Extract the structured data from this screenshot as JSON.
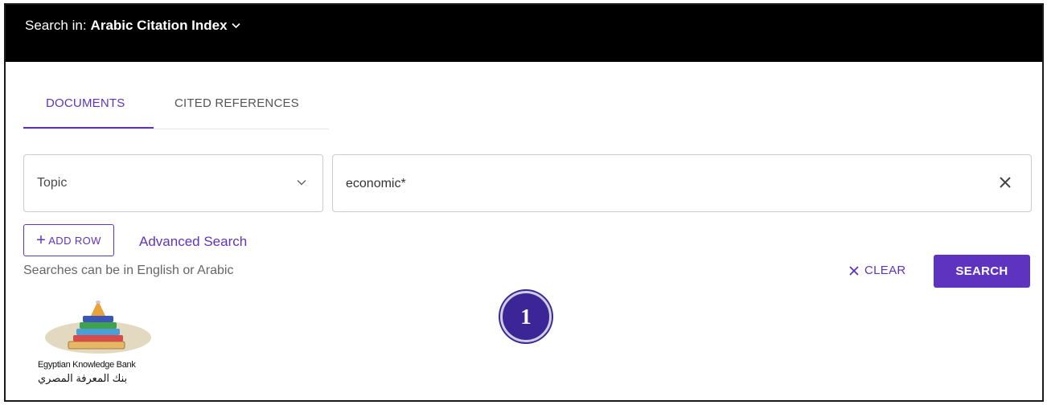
{
  "header": {
    "search_in_label": "Search in:",
    "database": "Arabic Citation Index"
  },
  "tabs": [
    {
      "label": "DOCUMENTS",
      "active": true
    },
    {
      "label": "CITED REFERENCES",
      "active": false
    }
  ],
  "search_row": {
    "field": "Topic",
    "query": "economic*"
  },
  "actions": {
    "add_row": "ADD ROW",
    "advanced_search": "Advanced Search",
    "clear": "CLEAR",
    "search": "SEARCH"
  },
  "hint": "Searches can be in English or Arabic",
  "badge": "1",
  "logo": {
    "name_en": "Egyptian Knowledge Bank",
    "name_ar": "بنك المعرفة المصري"
  },
  "colors": {
    "accent": "#5e33bf",
    "header_bg": "#000000",
    "badge_bg": "#3c2596"
  },
  "icons": [
    "chevron-down-icon",
    "close-icon",
    "plus-icon",
    "book-stack-logo"
  ]
}
